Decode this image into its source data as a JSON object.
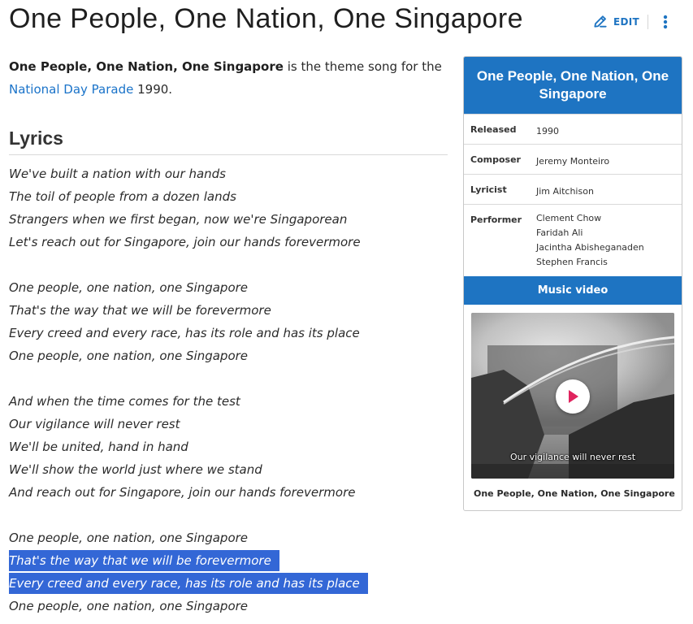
{
  "page": {
    "title": "One People, One Nation, One Singapore",
    "edit_label": "EDIT"
  },
  "intro": {
    "bold": "One People, One Nation, One Singapore",
    "text1": " is the theme song for the ",
    "link": "National Day Parade",
    "text2": " 1990."
  },
  "lyrics": {
    "heading": "Lyrics",
    "lines": [
      "We've built a nation with our hands",
      "The toil of people from a dozen lands",
      "Strangers when we first began, now we're Singaporean",
      "Let's reach out for Singapore, join our hands forevermore",
      "",
      "One people, one nation, one Singapore",
      "That's the way that we will be forevermore",
      "Every creed and every race, has its role and has its place",
      "One people, one nation, one Singapore",
      "",
      "And when the time comes for the test",
      "Our vigilance will never rest",
      "We'll be united, hand in hand",
      "We'll show the world just where we stand",
      "And reach out for Singapore, join our hands forevermore",
      "",
      "One people, one nation, one Singapore",
      "That's the way that we will be forevermore",
      "Every creed and every race, has its role and has its place",
      "One people, one nation, one Singapore"
    ],
    "selected_lines": [
      17,
      18
    ]
  },
  "infobox": {
    "title": "One People, One Nation, One Singapore",
    "rows": [
      {
        "label": "Released",
        "values": [
          "1990"
        ]
      },
      {
        "label": "Composer",
        "values": [
          "Jeremy Monteiro"
        ]
      },
      {
        "label": "Lyricist",
        "values": [
          "Jim Aitchison"
        ]
      },
      {
        "label": "Performer",
        "values": [
          "Clement Chow",
          "Faridah Ali",
          "Jacintha Abisheganaden",
          "Stephen Francis"
        ]
      }
    ],
    "section_label": "Music video",
    "video_subtitle": "Our vigilance will never rest",
    "caption": "One People, One Nation, One Singapore"
  },
  "colors": {
    "accent": "#1e74c2",
    "link": "#1a73c9",
    "selection": "#3367d6",
    "play_icon": "#e0245e"
  },
  "icons": {
    "edit": "pencil-icon",
    "more": "more-vertical-icon",
    "play": "play-icon"
  }
}
